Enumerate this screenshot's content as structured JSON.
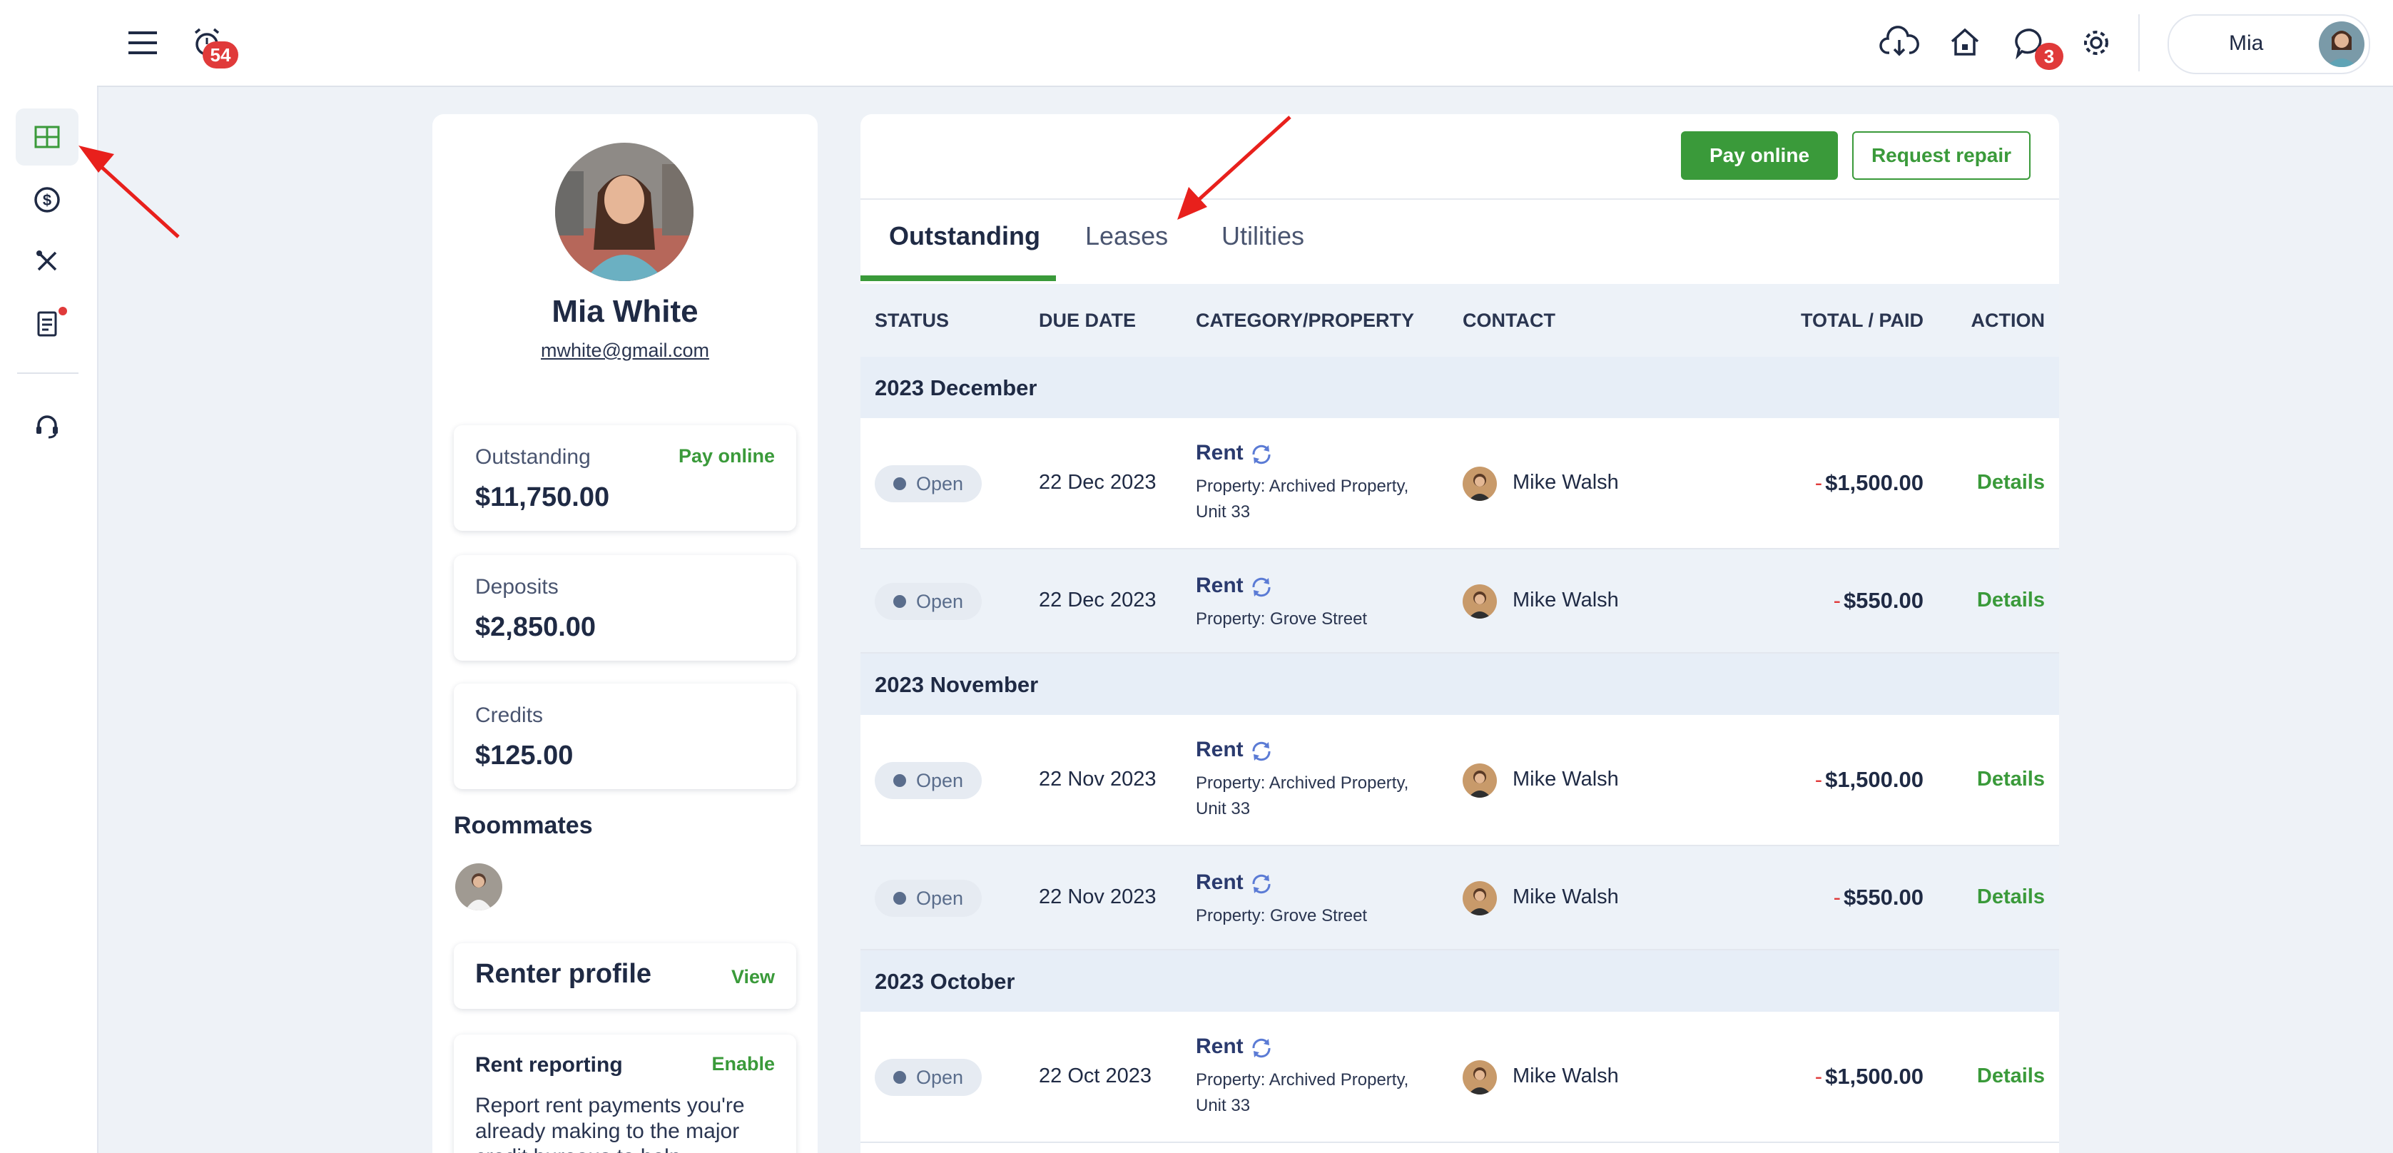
{
  "header": {
    "alarm_badge": "54",
    "messages_badge": "3",
    "user_name": "Mia"
  },
  "profile": {
    "name": "Mia White",
    "email": "mwhite@gmail.com",
    "outstanding_label": "Outstanding",
    "outstanding_link": "Pay online",
    "outstanding_value": "$11,750.00",
    "deposits_label": "Deposits",
    "deposits_value": "$2,850.00",
    "credits_label": "Credits",
    "credits_value": "$125.00",
    "roommates_title": "Roommates",
    "renter_profile_label": "Renter profile",
    "renter_profile_link": "View",
    "rent_reporting_label": "Rent reporting",
    "rent_reporting_link": "Enable",
    "rent_reporting_desc": "Report rent payments you're already making to the major credit bureaus to help"
  },
  "actions": {
    "pay_online": "Pay online",
    "request_repair": "Request repair"
  },
  "tabs": [
    "Outstanding",
    "Leases",
    "Utilities"
  ],
  "table": {
    "columns": [
      "STATUS",
      "DUE DATE",
      "CATEGORY/PROPERTY",
      "CONTACT",
      "TOTAL / PAID",
      "ACTION"
    ],
    "groups": [
      {
        "label": "2023 December",
        "rows": [
          {
            "status": "Open",
            "due": "22 Dec 2023",
            "category": "Rent",
            "property": "Property: Archived Property, Unit 33",
            "contact": "Mike Walsh",
            "amount": "$1,500.00",
            "action": "Details"
          },
          {
            "status": "Open",
            "due": "22 Dec 2023",
            "category": "Rent",
            "property": "Property: Grove Street",
            "contact": "Mike Walsh",
            "amount": "$550.00",
            "action": "Details"
          }
        ]
      },
      {
        "label": "2023 November",
        "rows": [
          {
            "status": "Open",
            "due": "22 Nov 2023",
            "category": "Rent",
            "property": "Property: Archived Property, Unit 33",
            "contact": "Mike Walsh",
            "amount": "$1,500.00",
            "action": "Details"
          },
          {
            "status": "Open",
            "due": "22 Nov 2023",
            "category": "Rent",
            "property": "Property: Grove Street",
            "contact": "Mike Walsh",
            "amount": "$550.00",
            "action": "Details"
          }
        ]
      },
      {
        "label": "2023 October",
        "rows": [
          {
            "status": "Open",
            "due": "22 Oct 2023",
            "category": "Rent",
            "property": "Property: Archived Property, Unit 33",
            "contact": "Mike Walsh",
            "amount": "$1,500.00",
            "action": "Details"
          }
        ]
      }
    ],
    "negative_sign": "-"
  },
  "colors": {
    "accent": "#3a9a3a",
    "badge": "#e03a3a",
    "annotation_arrow": "#e8201c"
  }
}
